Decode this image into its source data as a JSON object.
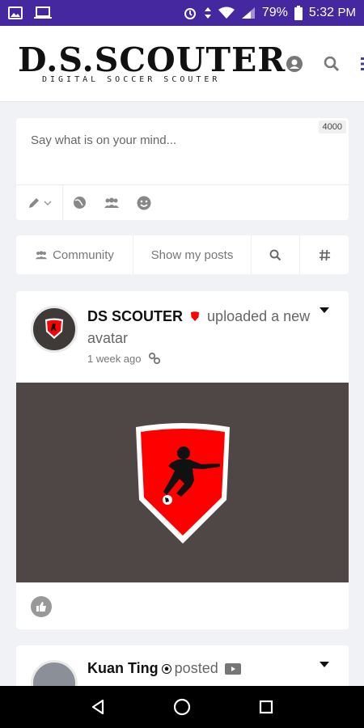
{
  "status_bar": {
    "battery": "79%",
    "time": "5:32",
    "ampm": "PM"
  },
  "header": {
    "logo_main": "D.S.SCOUTER",
    "logo_sub": "DIGITAL SOCCER SCOUTER"
  },
  "composer": {
    "placeholder": "Say what is on your mind...",
    "char_count": "4000"
  },
  "filters": {
    "community": "Community",
    "show_my_posts": "Show my posts"
  },
  "posts": [
    {
      "author": "DS SCOUTER",
      "action": "uploaded a new avatar",
      "time": "1 week ago"
    },
    {
      "author": "Kuan Ting",
      "action": "posted"
    }
  ],
  "colors": {
    "status_bar": "#4527a0",
    "accent": "#3f3fa0",
    "shield_red": "#ff0000",
    "image_bg": "#4f4745"
  }
}
